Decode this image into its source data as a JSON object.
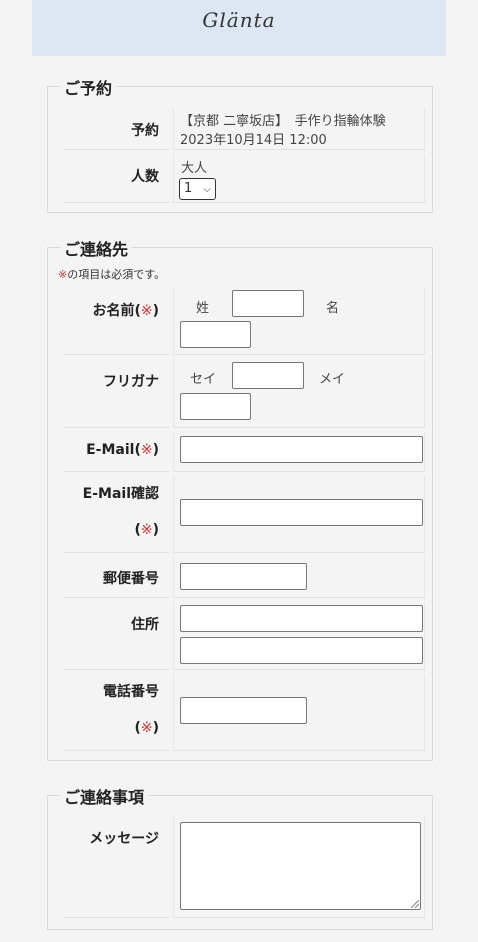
{
  "brand": {
    "logo": "Glänta"
  },
  "reservation": {
    "heading": "ご予約",
    "booking_label": "予約",
    "booking_line1": "【京都 二寧坂店】　手作り指輪体験",
    "booking_line2": "2023年10月14日 12:00",
    "people_label": "人数",
    "people_type": "大人",
    "people_value": "1"
  },
  "contact": {
    "heading": "ご連絡先",
    "required_mark": "※",
    "required_note": "の項目は必須です。",
    "name_label": "お名前",
    "surname_label": "姓",
    "given_label": "名",
    "kana_label": "フリガナ",
    "kana_surname_label": "セイ",
    "kana_given_label": "メイ",
    "email_label": "E-Mail",
    "email_confirm_label": "E-Mail確認",
    "postal_label": "郵便番号",
    "address_label": "住所",
    "phone_label": "電話番号",
    "paren_open": "(",
    "paren_close": ")"
  },
  "notes": {
    "heading": "ご連絡事項",
    "message_label": "メッセージ"
  }
}
